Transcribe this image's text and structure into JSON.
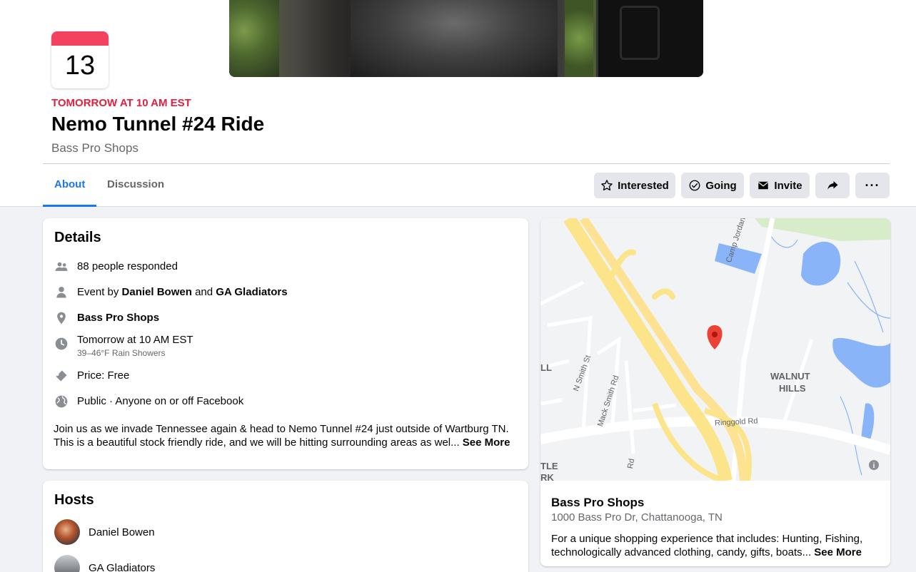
{
  "event": {
    "date_day": "13",
    "when": "TOMORROW AT 10 AM EST",
    "title": "Nemo Tunnel #24 Ride",
    "location_name": "Bass Pro Shops"
  },
  "tabs": [
    {
      "label": "About",
      "active": true
    },
    {
      "label": "Discussion",
      "active": false
    }
  ],
  "actions": {
    "interested": "Interested",
    "going": "Going",
    "invite": "Invite",
    "share_icon": "share-icon",
    "more_icon": "more-icon",
    "more_label": "···"
  },
  "details": {
    "heading": "Details",
    "responded": "88 people responded",
    "event_by_prefix": "Event by ",
    "host1": "Daniel Bowen",
    "and": " and ",
    "host2": "GA Gladiators",
    "place": "Bass Pro Shops",
    "time": "Tomorrow at 10 AM EST",
    "weather": "39–46°F Rain Showers",
    "price": "Price: Free",
    "privacy": "Public · Anyone on or off Facebook",
    "description_line1": "Join us as we invade Tennessee again & head to Nemo Tunnel #24 just outside of Wartburg TN.",
    "description_line2": "This is a beautiful stock friendly ride, and we will be hitting surrounding areas as wel...",
    "see_more": "See More"
  },
  "hosts": {
    "heading": "Hosts",
    "list": [
      {
        "name": "Daniel Bowen"
      },
      {
        "name": "GA Gladiators"
      }
    ]
  },
  "map": {
    "labels": {
      "walnut": "WALNUT",
      "hills": "HILLS",
      "ringgold": "Ringgold Rd",
      "camp_jordan": "Camp Jordan Pkwy",
      "n_smith": "N Smith St",
      "mack_smith": "Mack Smith Rd",
      "tle": "TLE",
      "rk": "RK",
      "ll": "LL",
      "rd": "Rd"
    },
    "place_name": "Bass Pro Shops",
    "address": "1000 Bass Pro Dr, Chattanooga, TN",
    "about_line1": "For a unique shopping experience that includes: Hunting, Fishing,",
    "about_line2": "technologically advanced clothing, candy, gifts, boats...",
    "see_more": "See More"
  },
  "colors": {
    "accent": "#1877f2",
    "date_red": "#e41e3f",
    "button_bg": "#e4e6eb",
    "page_bg": "#f0f2f5"
  }
}
